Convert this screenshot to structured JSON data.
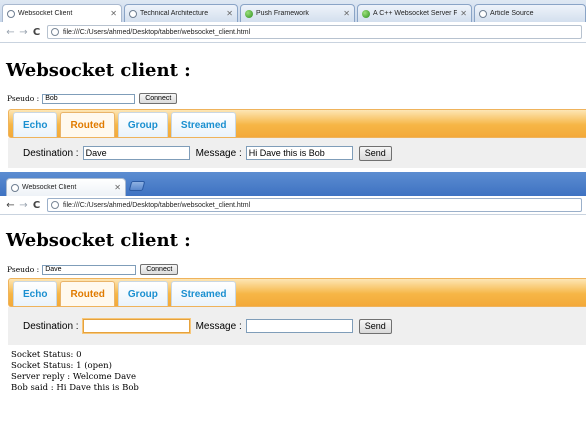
{
  "window1": {
    "tabs": [
      {
        "title": "Websocket Client",
        "icon": "page-icon",
        "active": true
      },
      {
        "title": "Technical Architecture",
        "icon": "page-icon",
        "active": false
      },
      {
        "title": "Push Framework",
        "icon": "green-globe-icon",
        "active": false
      },
      {
        "title": "A C++ Websocket Server For",
        "icon": "green-globe-icon",
        "active": false
      },
      {
        "title": "Article Source",
        "icon": "page-icon",
        "active": false
      }
    ],
    "url": "file:///C:/Users/ahmed/Desktop/tabber/websocket_client.html",
    "page_title": "Websocket client :",
    "pseudo_label": "Pseudo :",
    "pseudo_value": "Bob",
    "connect_label": "Connect",
    "nav_tabs": [
      "Echo",
      "Routed",
      "Group",
      "Streamed"
    ],
    "selected_tab": "Routed",
    "destination_label": "Destination :",
    "destination_value": "Dave",
    "message_label": "Message :",
    "message_value": "Hi Dave this is Bob",
    "send_label": "Send"
  },
  "window2": {
    "tabs": [
      {
        "title": "Websocket Client",
        "icon": "page-icon",
        "active": true
      }
    ],
    "url": "file:///C:/Users/ahmed/Desktop/tabber/websocket_client.html",
    "page_title": "Websocket client :",
    "pseudo_label": "Pseudo :",
    "pseudo_value": "Dave",
    "connect_label": "Connect",
    "nav_tabs": [
      "Echo",
      "Routed",
      "Group",
      "Streamed"
    ],
    "selected_tab": "Routed",
    "destination_label": "Destination :",
    "destination_value": "",
    "message_label": "Message :",
    "message_value": "",
    "send_label": "Send",
    "log": [
      "Socket Status: 0",
      "Socket Status: 1 (open)",
      "Server reply : Welcome Dave",
      "Bob said : Hi Dave this is Bob"
    ]
  },
  "colors": {
    "tabbar_orange": "#f6b646",
    "tab_text_blue": "#1a8fd0",
    "tab_selected_text": "#e07b00",
    "chrome_blue_active": "#3e72c2"
  }
}
